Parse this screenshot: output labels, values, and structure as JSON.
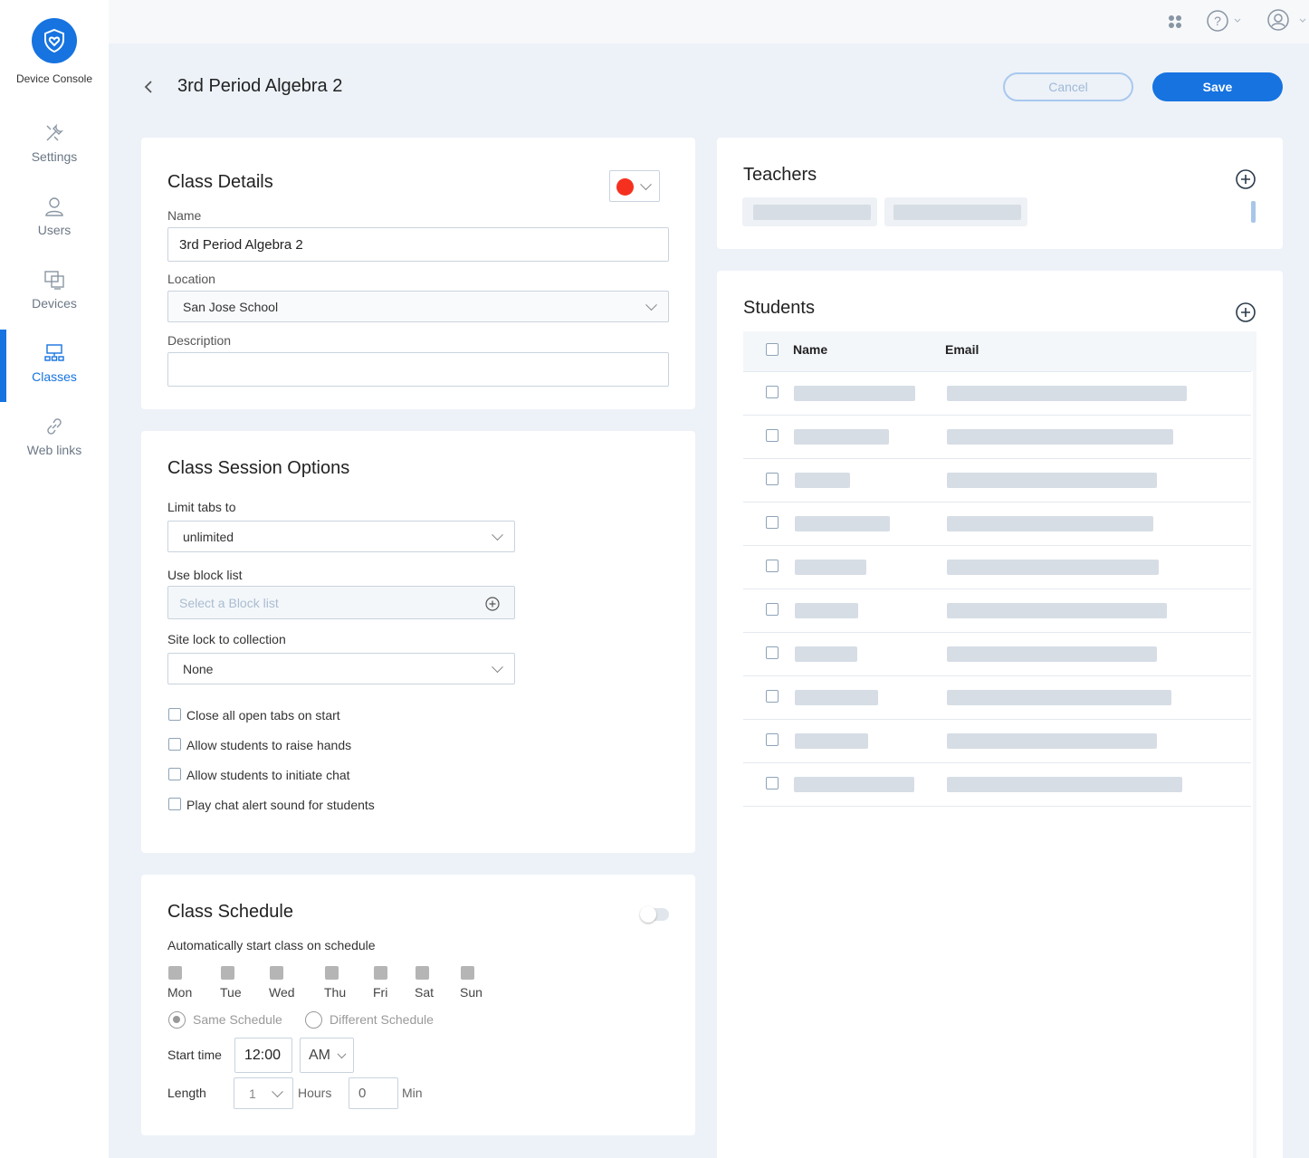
{
  "app": {
    "brand": "Device Console"
  },
  "sidebar": {
    "items": [
      {
        "label": "Settings",
        "icon": "tools-icon"
      },
      {
        "label": "Users",
        "icon": "user-icon"
      },
      {
        "label": "Devices",
        "icon": "devices-icon"
      },
      {
        "label": "Classes",
        "icon": "classes-icon",
        "active": true
      },
      {
        "label": "Web links",
        "icon": "link-icon"
      }
    ]
  },
  "topbar": {
    "icons": [
      "apps-grid-icon",
      "help-icon",
      "account-icon"
    ]
  },
  "header": {
    "title": "3rd Period Algebra 2",
    "cancel_label": "Cancel",
    "save_label": "Save"
  },
  "class_details": {
    "title": "Class Details",
    "color": "#f5301f",
    "name_label": "Name",
    "name_value": "3rd Period Algebra 2",
    "location_label": "Location",
    "location_value": "San Jose School",
    "description_label": "Description",
    "description_value": ""
  },
  "session_options": {
    "title": "Class Session Options",
    "limit_tabs_label": "Limit tabs to",
    "limit_tabs_value": "unlimited",
    "block_list_label": "Use block list",
    "block_list_placeholder": "Select a Block list",
    "site_lock_label": "Site lock to collection",
    "site_lock_value": "None",
    "checkboxes": [
      "Close all open tabs on start",
      "Allow students to raise hands",
      "Allow students to initiate chat",
      "Play chat alert sound for students"
    ]
  },
  "schedule": {
    "title": "Class Schedule",
    "enabled": false,
    "auto_start_label": "Automatically start class on schedule",
    "days": [
      "Mon",
      "Tue",
      "Wed",
      "Thu",
      "Fri",
      "Sat",
      "Sun"
    ],
    "same_schedule_label": "Same Schedule",
    "different_schedule_label": "Different Schedule",
    "start_time_label": "Start time",
    "start_time_value": "12:00",
    "ampm_value": "AM",
    "length_label": "Length",
    "hours_value": "1",
    "hours_label": "Hours",
    "min_value": "0",
    "min_label": "Min"
  },
  "teachers": {
    "title": "Teachers"
  },
  "students": {
    "title": "Students",
    "col_name": "Name",
    "col_email": "Email"
  }
}
